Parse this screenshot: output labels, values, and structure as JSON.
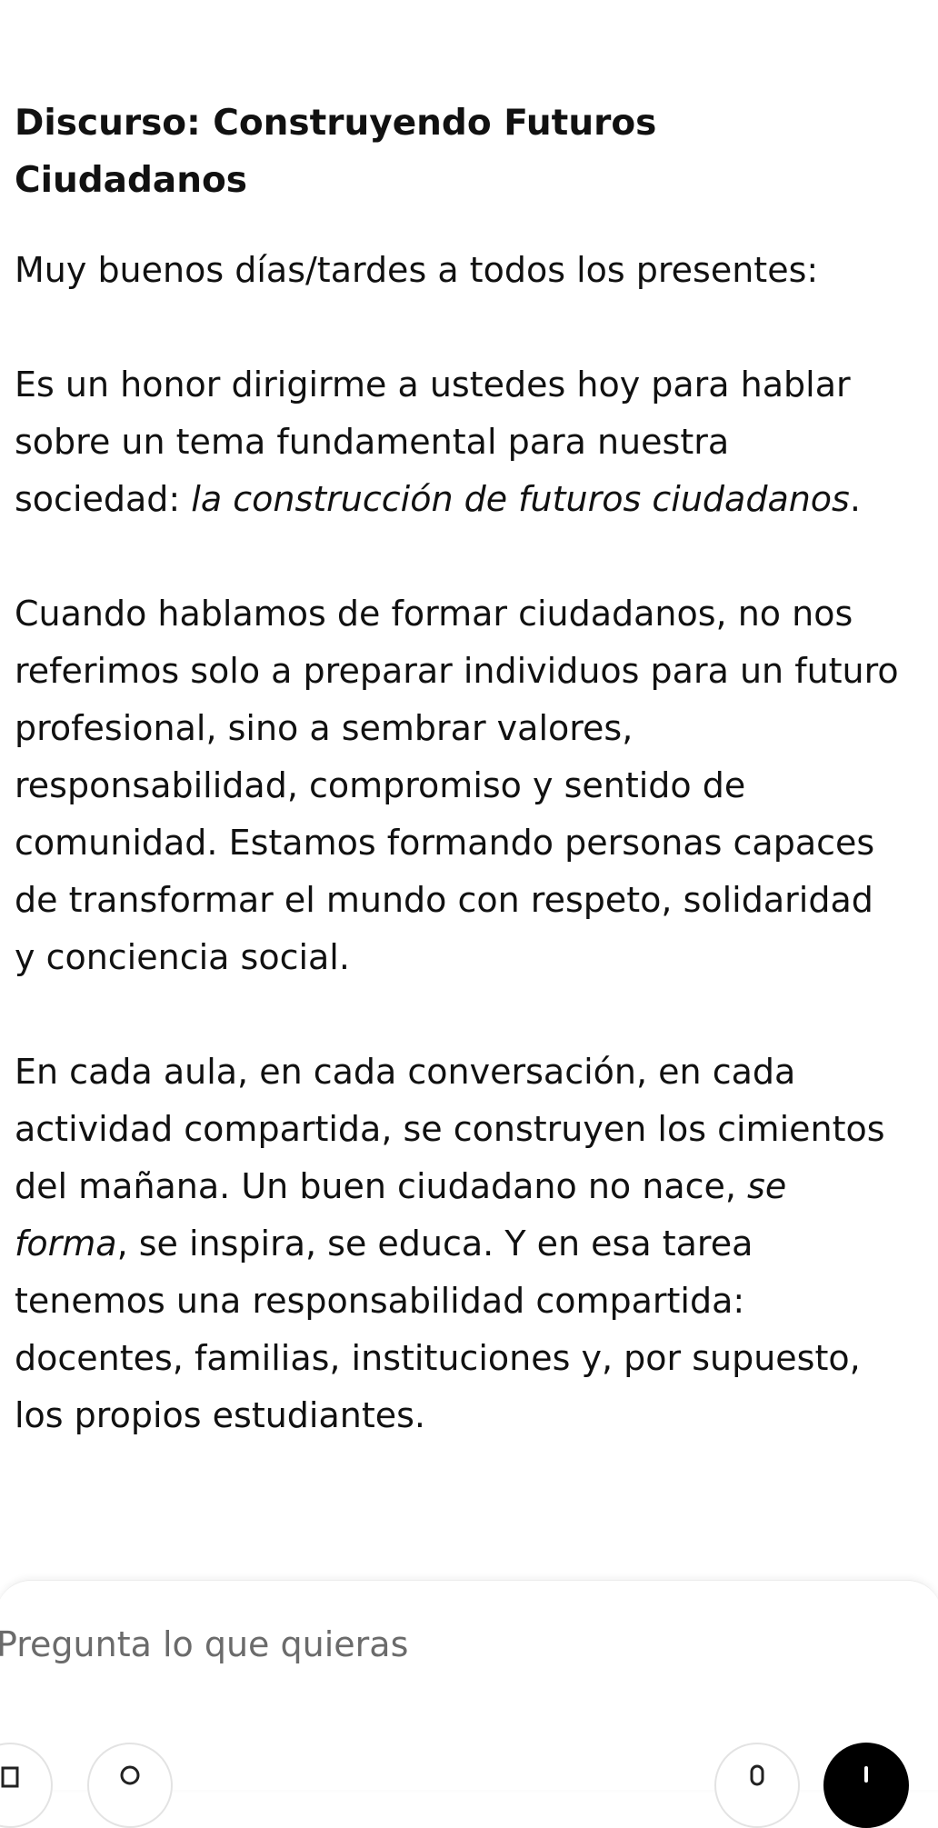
{
  "document": {
    "title": "Discurso: Construyendo Futuros Ciudadanos",
    "greeting": "Muy buenos días/tardes a todos los presentes:",
    "p2_text": "Es un honor dirigirme a ustedes hoy para hablar sobre un tema fundamental para nuestra sociedad: ",
    "p2_emphasis": "la construcción de futuros ciudadanos",
    "p2_end": ".",
    "p3": "Cuando hablamos de formar ciudadanos, no nos referimos solo a preparar individuos para un futuro profesional, sino a sembrar valores, responsabilidad, compromiso y sentido de comunidad. Estamos formando personas capaces de transformar el mundo con respeto, solidaridad y conciencia social.",
    "p4_start": "En cada aula, en cada conversación, en cada actividad compartida, se construyen los cimientos del mañana. Un buen ciudadano no nace, ",
    "p4_emphasis": "se forma",
    "p4_end": ", se inspira, se educa. Y en esa tarea tenemos una responsabilidad compartida: docentes, familias, instituciones y, por supuesto, los propios estudiantes."
  },
  "composer": {
    "placeholder": "Pregunta lo que quieras",
    "icons": {
      "attach": "attach-icon",
      "tools": "tools-icon",
      "mic": "mic-icon",
      "voice": "voice-mode-icon"
    },
    "colors": {
      "placeholder": "#6b6b6b",
      "voice_button": "#000000"
    }
  }
}
